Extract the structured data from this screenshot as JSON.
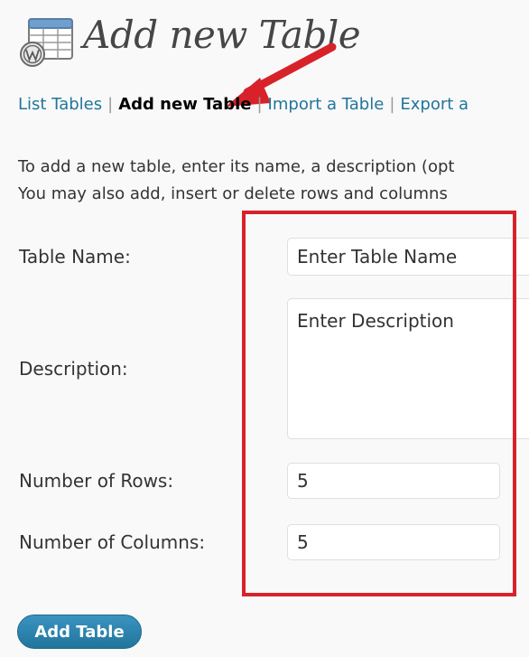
{
  "header": {
    "title": "Add new Table",
    "icon": "table-icon"
  },
  "subnav": {
    "items": [
      {
        "label": "List Tables",
        "current": false
      },
      {
        "label": "Add new Table",
        "current": true
      },
      {
        "label": "Import a Table",
        "current": false
      },
      {
        "label": "Export a",
        "current": false
      }
    ],
    "separator": "|"
  },
  "intro": {
    "line1": "To add a new table, enter its name, a description (opt",
    "line2": "You may also add, insert or delete rows and columns"
  },
  "form": {
    "table_name_label": "Table Name:",
    "table_name_value": "Enter Table Name",
    "description_label": "Description:",
    "description_value": "Enter Description",
    "rows_label": "Number of Rows:",
    "rows_value": "5",
    "columns_label": "Number of Columns:",
    "columns_value": "5",
    "submit_label": "Add Table"
  },
  "colors": {
    "link": "#21759b",
    "annotation_red": "#d8222a",
    "button": "#21759b"
  }
}
